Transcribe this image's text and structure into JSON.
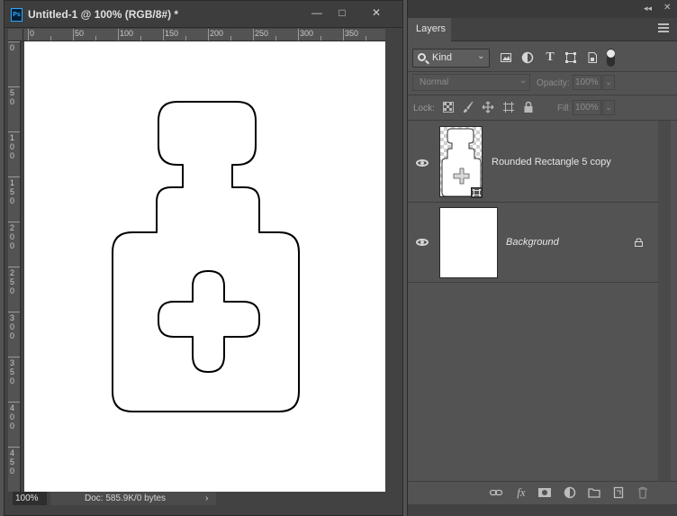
{
  "document": {
    "app_icon_text": "Ps",
    "title": "Untitled-1 @ 100% (RGB/8#) *",
    "window_buttons": {
      "minimize": "—",
      "restore": "□",
      "close": "✕"
    },
    "ruler_h_ticks": [
      "0",
      "50",
      "100",
      "150",
      "200",
      "250",
      "300",
      "350"
    ],
    "ruler_v_ticks": [
      "0",
      "50",
      "100",
      "150",
      "200",
      "250",
      "300",
      "350",
      "400",
      "450"
    ],
    "status": {
      "zoom": "100%",
      "doc_info": "Doc: 585.9K/0 bytes",
      "arrow": "›"
    }
  },
  "panel": {
    "tab": "Layers",
    "filter": {
      "kind_label": "Kind"
    },
    "blend_mode": "Normal",
    "opacity_label": "Opacity:",
    "opacity_value": "100%",
    "lock_label": "Lock:",
    "fill_label": "Fill:",
    "fill_value": "100%",
    "layers": [
      {
        "name": "Rounded Rectangle 5 copy",
        "visible": true
      },
      {
        "name": "Background",
        "visible": true,
        "locked": true
      }
    ]
  }
}
